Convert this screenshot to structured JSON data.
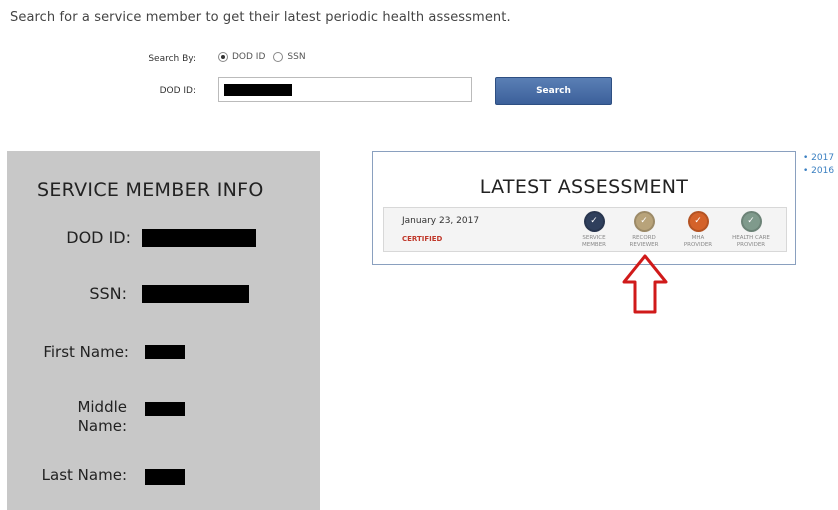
{
  "instruction": "Search for a service member to get their latest periodic health assessment.",
  "search": {
    "search_by_label": "Search By:",
    "options": [
      {
        "label": "DOD ID",
        "selected": true
      },
      {
        "label": "SSN",
        "selected": false
      }
    ],
    "dodid_label": "DOD ID:",
    "button_label": "Search"
  },
  "info": {
    "title": "SERVICE MEMBER INFO",
    "labels": {
      "dodid": "DOD ID:",
      "ssn": "SSN:",
      "first_name": "First Name:",
      "middle_name": "Middle\nName:",
      "last_name": "Last Name:"
    }
  },
  "assessment": {
    "title": "LATEST ASSESSMENT",
    "date": "January 23, 2017",
    "status": "CERTIFIED",
    "status_color": "#c0392b",
    "steps": [
      {
        "label": "SERVICE\nMEMBER",
        "color": "#2f3f5c",
        "icon": "check-icon"
      },
      {
        "label": "RECORD\nREVIEWER",
        "color": "#b8a37a",
        "icon": "check-icon"
      },
      {
        "label": "MHA\nPROVIDER",
        "color": "#d4622a",
        "icon": "check-icon"
      },
      {
        "label": "HEALTH CARE\nPROVIDER",
        "color": "#7f9a8c",
        "icon": "check-icon"
      }
    ]
  },
  "years": [
    "• 2017",
    "• 2016"
  ],
  "colors": {
    "accent": "#3c609a",
    "link": "#3a7fc1",
    "arrow": "#d01a1a"
  }
}
